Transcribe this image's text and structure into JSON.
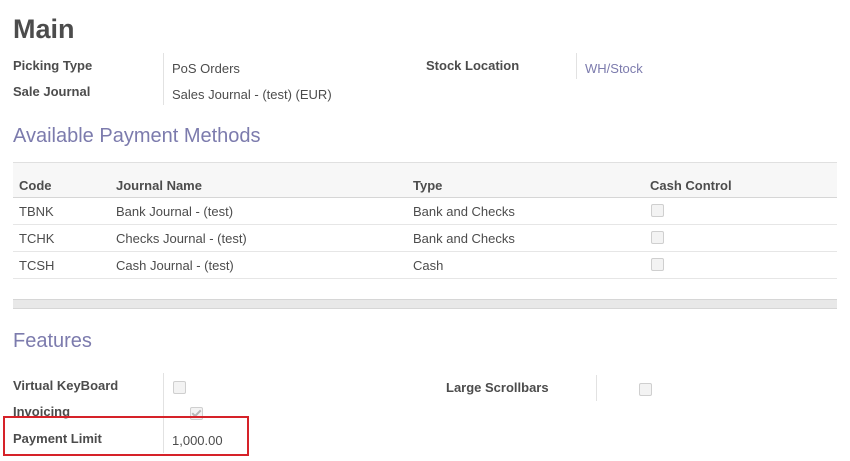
{
  "page_title": "Main",
  "main": {
    "picking_type": {
      "label": "Picking Type",
      "value": "PoS Orders"
    },
    "sale_journal": {
      "label": "Sale Journal",
      "value": "Sales Journal - (test) (EUR)"
    },
    "stock_location": {
      "label": "Stock Location",
      "value": "WH/Stock"
    }
  },
  "payment_methods": {
    "title": "Available Payment Methods",
    "columns": [
      "Code",
      "Journal Name",
      "Type",
      "Cash Control"
    ],
    "rows": [
      {
        "code": "TBNK",
        "journal": "Bank Journal - (test)",
        "type": "Bank and Checks",
        "cash_control": false
      },
      {
        "code": "TCHK",
        "journal": "Checks Journal - (test)",
        "type": "Bank and Checks",
        "cash_control": false
      },
      {
        "code": "TCSH",
        "journal": "Cash Journal - (test)",
        "type": "Cash",
        "cash_control": false
      }
    ]
  },
  "features": {
    "title": "Features",
    "virtual_keyboard": {
      "label": "Virtual KeyBoard",
      "checked": false
    },
    "invoicing": {
      "label": "Invoicing",
      "checked": true
    },
    "payment_limit": {
      "label": "Payment Limit",
      "value": "1,000.00"
    },
    "large_scrollbars": {
      "label": "Large Scrollbars",
      "checked": false
    }
  },
  "colors": {
    "accent": "#7c7bad",
    "highlight": "#d62229",
    "text": "#4c4c4c"
  }
}
